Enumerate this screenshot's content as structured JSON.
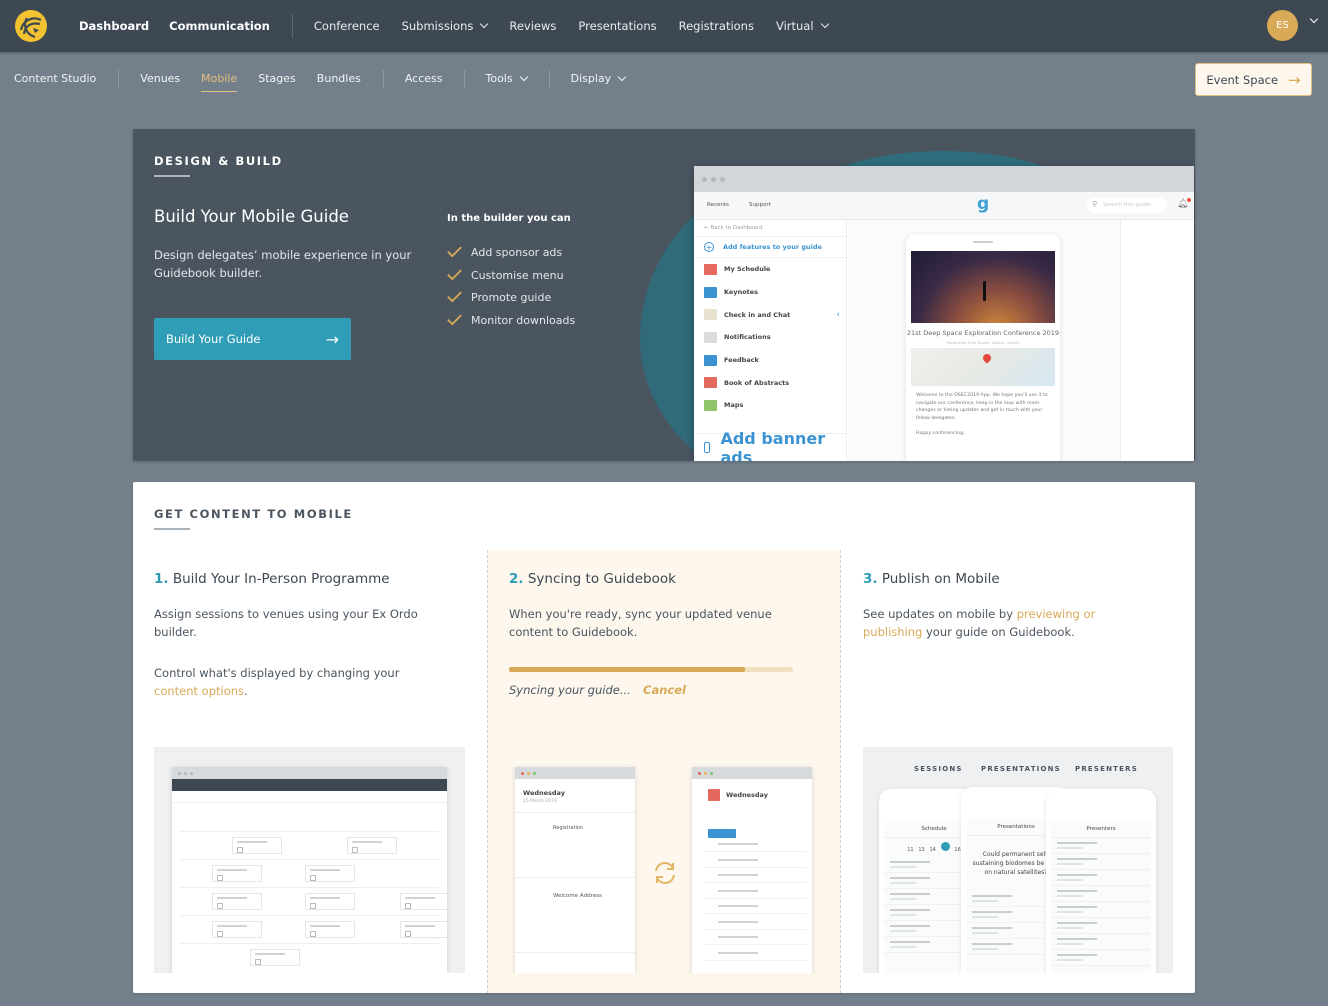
{
  "topbar": {
    "nav_primary": [
      "Dashboard",
      "Communication"
    ],
    "nav_secondary": [
      {
        "label": "Conference",
        "dropdown": false
      },
      {
        "label": "Submissions",
        "dropdown": true
      },
      {
        "label": "Reviews",
        "dropdown": false
      },
      {
        "label": "Presentations",
        "dropdown": false
      },
      {
        "label": "Registrations",
        "dropdown": false
      },
      {
        "label": "Virtual",
        "dropdown": true
      }
    ],
    "avatar_initials": "ES"
  },
  "subnav": {
    "items": [
      {
        "label": "Content Studio"
      },
      {
        "label": "Venues"
      },
      {
        "label": "Mobile",
        "active": true
      },
      {
        "label": "Stages"
      },
      {
        "label": "Bundles"
      },
      {
        "label": "Access"
      },
      {
        "label": "Tools",
        "dropdown": true
      },
      {
        "label": "Display",
        "dropdown": true
      }
    ],
    "event_space_label": "Event Space"
  },
  "hero": {
    "kicker": "DESIGN & BUILD",
    "title": "Build Your Mobile Guide",
    "description": "Design delegates’ mobile experience in your Guidebook builder.",
    "button_label": "Build Your Guide",
    "builder_heading": "In the builder you can",
    "builder_items": [
      "Add sponsor ads",
      "Customise menu",
      "Promote guide",
      "Monitor downloads"
    ],
    "mockup": {
      "toolbar": [
        "Recents",
        "Support"
      ],
      "logo": "g",
      "search_placeholder": "Search this guide",
      "back_link": "← Back to Dashboard",
      "add_features": "Add features to your guide",
      "features": [
        {
          "label": "My Schedule",
          "icon": "calendar-icon",
          "color": "#e4685e"
        },
        {
          "label": "Keynotes",
          "icon": "people-icon",
          "color": "#3b94d1"
        },
        {
          "label": "Check in and Chat",
          "icon": "folder-icon",
          "color": "#e6e2cf"
        },
        {
          "label": "Notifications",
          "icon": "envelope-icon",
          "color": "#dcdcdf"
        },
        {
          "label": "Feedback",
          "icon": "feedback-icon",
          "color": "#3b94d1"
        },
        {
          "label": "Book of Abstracts",
          "icon": "book-icon",
          "color": "#e4685e"
        },
        {
          "label": "Maps",
          "icon": "map-icon",
          "color": "#8fc46a"
        }
      ],
      "add_banner": "Add banner ads",
      "phone_title": "21st Deep Space Exploration Conference 2019",
      "phone_subtitle": "Portershed, Eyre Square, Galway, Ireland",
      "phone_text": "Welcome to the DSEC2019 App. We hope you'll use it to navigate our conference, keep in the loop with room changes or timing updates and get in touch with your fellow delegates.",
      "phone_sign": "Happy conferencing,"
    }
  },
  "content_card": {
    "kicker": "GET CONTENT TO MOBILE",
    "steps": [
      {
        "num": "1.",
        "title": "Build Your In-Person Programme",
        "text1": "Assign sessions to venues using your Ex Ordo builder.",
        "text2_prefix": "Control what's displayed by changing your ",
        "text2_link": "content options",
        "text2_suffix": "."
      },
      {
        "num": "2.",
        "title": "Syncing to Guidebook",
        "text1": "When you're ready, sync your updated venue content to Guidebook.",
        "progress_percent": 83,
        "status": "Syncing your guide...",
        "cancel_label": "Cancel",
        "left_window_day": "Wednesday",
        "left_window_date": "15 March 2019",
        "left_items": [
          "Registration",
          "Welcome Address"
        ],
        "right_window_day": "Wednesday"
      },
      {
        "num": "3.",
        "title": "Publish on Mobile",
        "text_prefix": "See updates on mobile by ",
        "text_link": "previewing or publishing",
        "text_suffix": " your guide on Guidebook.",
        "tabs": [
          "SESSIONS",
          "PRESENTATIONS",
          "PRESENTERS"
        ],
        "phone_headers": [
          "Schedule",
          "Presentations",
          "Presenters"
        ],
        "presentation_question": "Could permanent self-sustaining biodomes be built on natural satellites?"
      }
    ]
  },
  "colors": {
    "topbar": "#3d4853",
    "accent_gold": "#d8a957",
    "accent_teal": "#2f9db5",
    "page_bg": "#737f8b"
  }
}
